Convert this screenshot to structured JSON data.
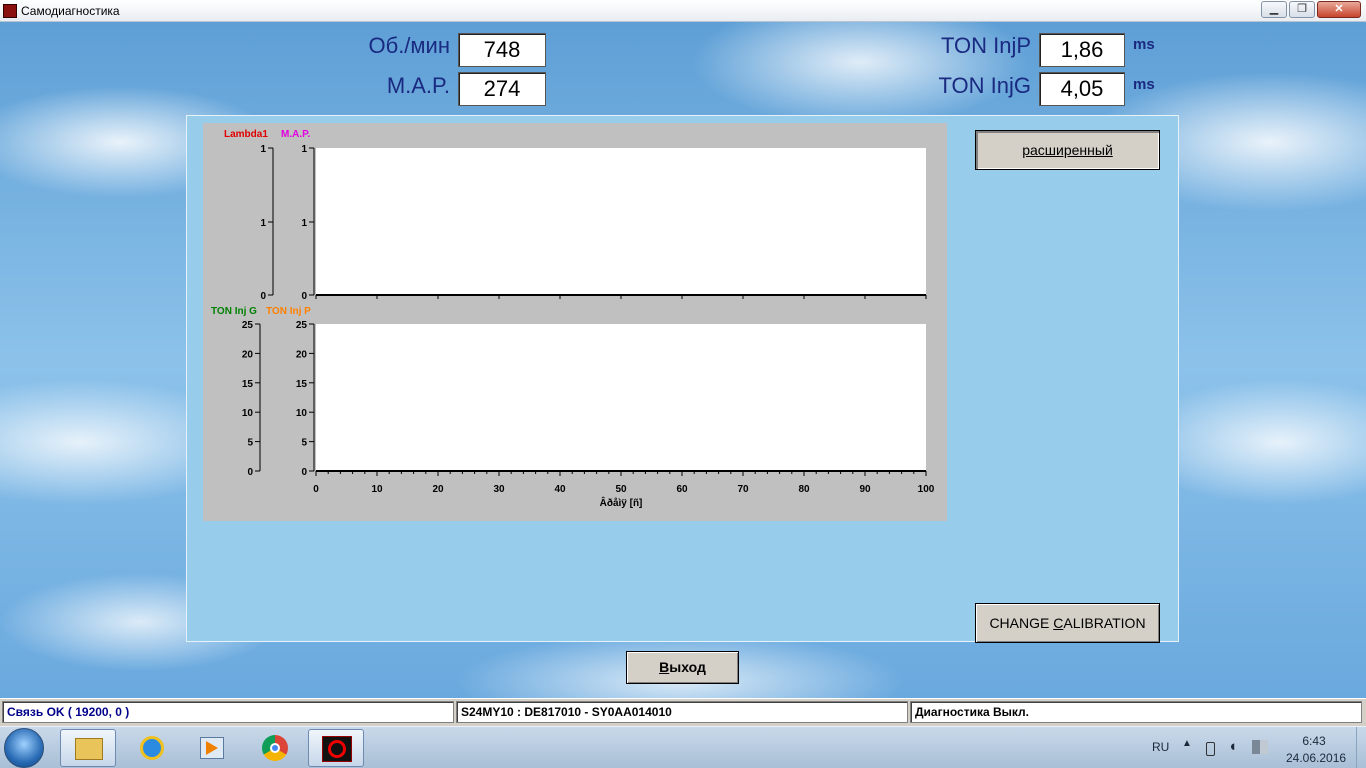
{
  "window": {
    "title": "Самодиагностика",
    "min": "▁",
    "max": "❐",
    "close": "✕"
  },
  "readouts": {
    "rpm": {
      "label": "Об./мин",
      "value": "748"
    },
    "map": {
      "label": "M.A.P.",
      "value": "274"
    },
    "ton_injp": {
      "label": "TON InjP",
      "value": "1,86",
      "unit": "ms"
    },
    "ton_injg": {
      "label": "TON InjG",
      "value": "4,05",
      "unit": "ms"
    }
  },
  "buttons": {
    "extended": "расширенный",
    "change_calibration_pre": "CHANGE ",
    "change_calibration_hot": "C",
    "change_calibration_post": "ALIBRATION",
    "exit_hot": "В",
    "exit_rest": "ыход"
  },
  "chart_data": [
    {
      "type": "line",
      "series": [
        {
          "name": "Lambda1",
          "color": "#e00000",
          "values": []
        },
        {
          "name": "M.A.P.",
          "color": "#e000e0",
          "values": []
        }
      ],
      "left_axis_ticks": [
        "1",
        "1",
        "0"
      ],
      "right_axis_ticks": [
        "1",
        "1",
        "0"
      ],
      "xlim": [
        0,
        100
      ]
    },
    {
      "type": "line",
      "series": [
        {
          "name": "TON Inj G",
          "color": "#008000",
          "values": []
        },
        {
          "name": "TON Inj P",
          "color": "#ff8000",
          "values": []
        }
      ],
      "y_ticks": [
        "25",
        "20",
        "15",
        "10",
        "5",
        "0"
      ],
      "ylim": [
        0,
        25
      ],
      "x_ticks": [
        "0",
        "10",
        "20",
        "30",
        "40",
        "50",
        "60",
        "70",
        "80",
        "90",
        "100"
      ],
      "xlim": [
        0,
        100
      ],
      "xlabel": "Âðåìÿ [ñ]"
    }
  ],
  "status": {
    "connection": "Связь OK ( 19200,  0 )",
    "ecu": "S24MY10 : DE817010 - SY0AA014010",
    "diagnostics": "Диагностика Выкл."
  },
  "taskbar": {
    "apps": [
      "start-orb",
      "explorer-icon",
      "internet-explorer-icon",
      "media-player-icon",
      "chrome-icon",
      "pd-app-icon"
    ],
    "lang": "RU",
    "time": "6:43",
    "date": "24.06.2016"
  }
}
